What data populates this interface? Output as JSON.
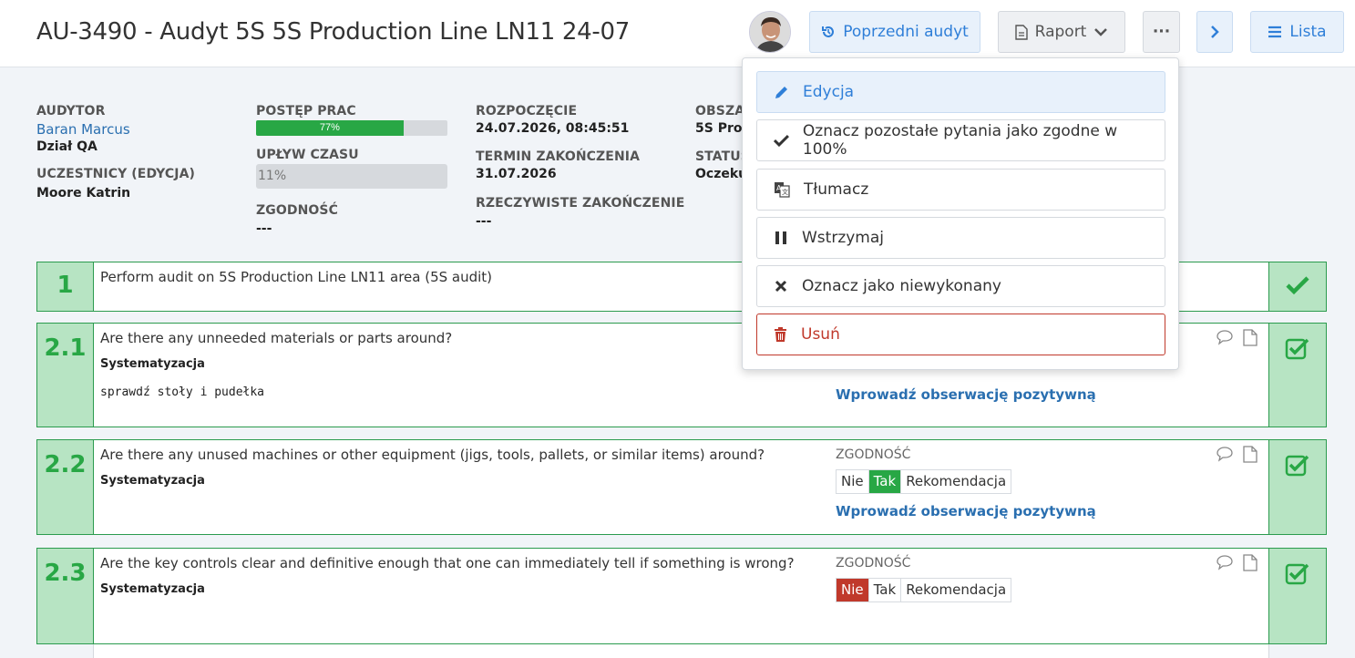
{
  "header": {
    "title": "AU-3490 - Audyt 5S 5S Production Line LN11 24-07",
    "prev_audit": "Poprzedni audyt",
    "report": "Raport",
    "more": "···",
    "list": "Lista"
  },
  "info": {
    "auditor_label": "AUDYTOR",
    "auditor_name": "Baran Marcus",
    "auditor_dept": "Dział QA",
    "participants_label": "UCZESTNICY (EDYCJA)",
    "participants": "Moore Katrin",
    "progress_label": "POSTĘP PRAC",
    "progress_value": 77,
    "progress_text": "77%",
    "elapsed_label": "UPŁYW CZASU",
    "elapsed_text": "11%",
    "compliance_label": "ZGODNOŚĆ",
    "compliance_value": "---",
    "start_label": "ROZPOCZĘCIE",
    "start_value": "24.07.2026, 08:45:51",
    "deadline_label": "TERMIN ZAKOŃCZENIA",
    "deadline_value": "31.07.2026",
    "actual_end_label": "RZECZYWISTE ZAKOŃCZENIE",
    "actual_end_value": "---",
    "area_label": "OBSZA",
    "area_value": "5S Proc",
    "status_label": "STATUS",
    "status_value": "Oczeku"
  },
  "menu": {
    "edit": "Edycja",
    "mark_compliant": "Oznacz pozostałe pytania jako zgodne w 100%",
    "translate": "Tłumacz",
    "pause": "Wstrzymaj",
    "mark_not_done": "Oznacz jako niewykonany",
    "delete": "Usuń"
  },
  "rows": [
    {
      "num": "1",
      "text": "Perform audit on 5S Production Line LN11 area (5S audit)"
    },
    {
      "num": "2.1",
      "text": "Are there any unneeded materials or parts around?",
      "category": "Systematyzacja",
      "note": "sprawdź stoły i pudełka",
      "observation": "Wprowadź obserwację pozytywną"
    },
    {
      "num": "2.2",
      "text": "Are there any unused machines or other equipment (jigs, tools, pallets, or similar items) around?",
      "category": "Systematyzacja",
      "compliance_label": "ZGODNOŚĆ",
      "options": [
        "Nie",
        "Tak",
        "Rekomendacja"
      ],
      "observation": "Wprowadź obserwację pozytywną"
    },
    {
      "num": "2.3",
      "text": "Are the key controls clear and definitive enough that one can immediately tell if something is wrong?",
      "category": "Systematyzacja",
      "compliance_label": "ZGODNOŚĆ",
      "options": [
        "Nie",
        "Tak",
        "Rekomendacja"
      ]
    }
  ]
}
